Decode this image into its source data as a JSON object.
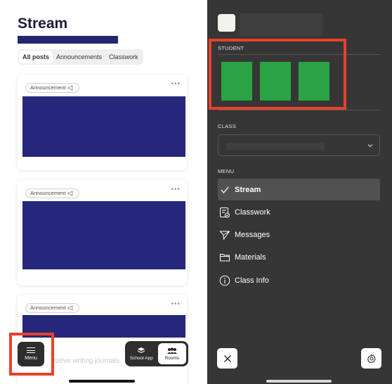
{
  "stream": {
    "title": "Stream",
    "tabs": [
      {
        "label": "All posts",
        "active": true
      },
      {
        "label": "Announcements",
        "active": false
      },
      {
        "label": "Classwork",
        "active": false
      }
    ],
    "cards": [
      {
        "badge": "Announcement",
        "more": "•••"
      },
      {
        "badge": "Announcement",
        "more": "•••"
      },
      {
        "badge": "Announcement",
        "more": "•••"
      }
    ],
    "partial_post_text": "eative writing journals"
  },
  "bottom_bar": {
    "menu_label": "Menu",
    "switcher": [
      {
        "label": "School App",
        "icon": "layers-icon",
        "active": false
      },
      {
        "label": "Rooms",
        "icon": "people-icon",
        "active": true
      }
    ]
  },
  "drawer": {
    "student_label": "STUDENT",
    "class_label": "CLASS",
    "menu_label": "MENU",
    "menu_items": [
      {
        "label": "Stream",
        "icon": "check-icon",
        "active": true
      },
      {
        "label": "Classwork",
        "icon": "classwork-icon",
        "active": false
      },
      {
        "label": "Messages",
        "icon": "send-icon",
        "active": false
      },
      {
        "label": "Materials",
        "icon": "folder-icon",
        "active": false
      },
      {
        "label": "Class Info",
        "icon": "info-icon",
        "active": false
      }
    ],
    "close_icon": "close-icon",
    "settings_icon": "gear-icon"
  },
  "colors": {
    "accent_navy": "#24286e",
    "highlight_red": "#e8412b",
    "swatch_green": "#2aa443",
    "drawer_bg": "#363636"
  }
}
